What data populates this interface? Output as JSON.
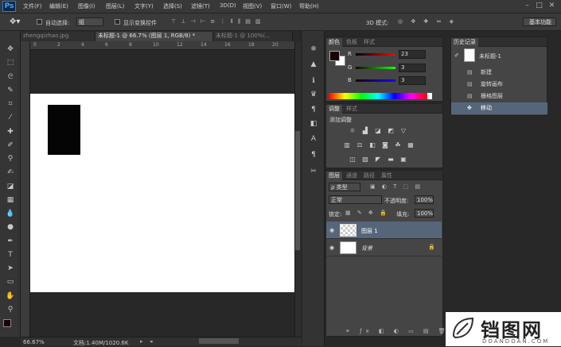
{
  "app": {
    "logo": "Ps"
  },
  "menu": [
    "文件(F)",
    "编辑(E)",
    "图像(I)",
    "图层(L)",
    "文字(Y)",
    "选择(S)",
    "滤镜(T)",
    "3D(D)",
    "视图(V)",
    "窗口(W)",
    "帮助(H)"
  ],
  "window_controls": {
    "minimize": "–",
    "maximize": "□",
    "close": "✕"
  },
  "options": {
    "auto_select_label": "自动选择:",
    "auto_select_value": "组",
    "show_transform_label": "显示变换控件",
    "mode_3d_label": "3D 模式:",
    "workspace_button": "基本功能"
  },
  "tabs": [
    {
      "label": "zhengqizhao.jpg",
      "active": false
    },
    {
      "label": "未标题-1 @ 66.7% (图层 1, RGB/8) *",
      "active": true
    },
    {
      "label": "未标题-1 @ 100%(...",
      "active": false
    }
  ],
  "ruler_ticks": [
    "0",
    "2",
    "4",
    "6",
    "8",
    "10",
    "12",
    "14",
    "16",
    "18",
    "20"
  ],
  "status": {
    "zoom": "66.67%",
    "doc_info": "文档:1.40M/1020.6K"
  },
  "color_panel": {
    "tabs": [
      "颜色",
      "色板",
      "样式"
    ],
    "channels": [
      {
        "label": "R",
        "value": "23"
      },
      {
        "label": "G",
        "value": "3"
      },
      {
        "label": "B",
        "value": "3"
      }
    ],
    "foreground": "#170303",
    "background": "#ffffff"
  },
  "adjustments_panel": {
    "tabs": [
      "调整",
      "样式"
    ],
    "title": "添加调整"
  },
  "layers_panel": {
    "tabs": [
      "图层",
      "通道",
      "路径",
      "属性"
    ],
    "filter_label": "ρ 类型",
    "blend_mode": "正常",
    "opacity_label": "不透明度:",
    "opacity_value": "100%",
    "lock_label": "锁定:",
    "fill_label": "填充:",
    "fill_value": "100%",
    "layers": [
      {
        "name": "图层 1",
        "selected": true
      },
      {
        "name": "背景",
        "selected": false
      }
    ]
  },
  "history_panel": {
    "tab": "历史记录",
    "snapshot": "未标题-1",
    "items": [
      {
        "label": "新建",
        "active": false
      },
      {
        "label": "旋转画布",
        "active": false
      },
      {
        "label": "栅格图层",
        "active": false
      },
      {
        "label": "移动",
        "active": true
      }
    ]
  },
  "watermark": {
    "text": "铛图网",
    "sub": "DOANDOAN.COM"
  }
}
